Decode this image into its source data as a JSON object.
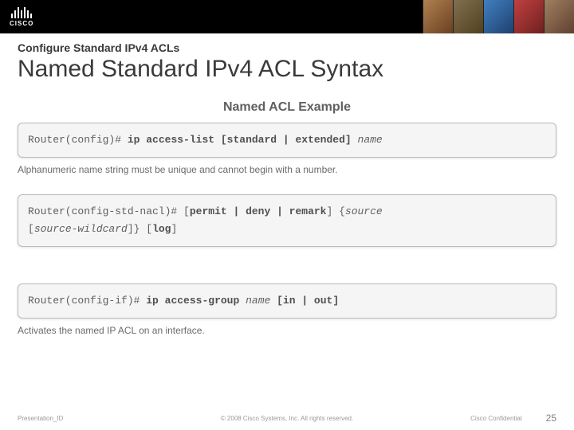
{
  "logo": {
    "text": "CISCO"
  },
  "overline": "Configure Standard IPv4 ACLs",
  "title": "Named Standard IPv4 ACL Syntax",
  "example_title": "Named ACL Example",
  "panel1": {
    "prompt": "Router(config)#",
    "cmd": "ip access-list [standard | extended]",
    "arg": "name"
  },
  "note1": "Alphanumeric name string must be unique and cannot begin with a number.",
  "panel2": {
    "prompt": "Router(config-std-nacl)#",
    "part_a": "[",
    "part_b": "permit | deny | remark",
    "part_c": "] {",
    "part_d": "source",
    "part_e": "[",
    "part_f": "source-wildcard",
    "part_g": "]} [",
    "part_h": "log",
    "part_i": "]"
  },
  "panel3": {
    "prompt": "Router(config-if)#",
    "cmd": "ip access-group",
    "arg": "name",
    "tail": "[in | out]"
  },
  "note3": "Activates the named IP ACL on an interface.",
  "footer": {
    "left": "Presentation_ID",
    "center": "© 2008 Cisco Systems, Inc. All rights reserved.",
    "conf": "Cisco Confidential",
    "page": "25"
  }
}
